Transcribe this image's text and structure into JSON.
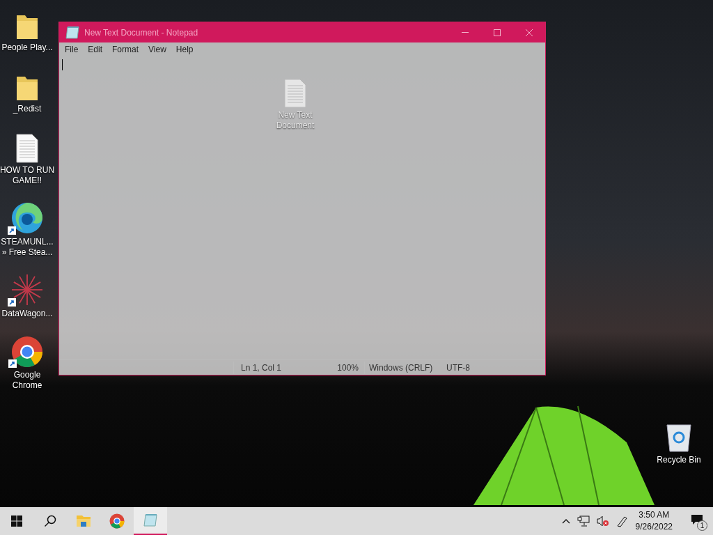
{
  "desktop_icons": [
    {
      "kind": "folder",
      "shortcut": false,
      "lines": [
        "People Play..."
      ]
    },
    {
      "kind": "folder",
      "shortcut": false,
      "lines": [
        "_Redist"
      ]
    },
    {
      "kind": "document",
      "shortcut": false,
      "lines": [
        "HOW TO RUN",
        "GAME!!"
      ]
    },
    {
      "kind": "browser-edge",
      "shortcut": true,
      "lines": [
        "STEAMUNL...",
        "» Free Stea..."
      ]
    },
    {
      "kind": "starburst",
      "shortcut": true,
      "lines": [
        "DataWagon..."
      ]
    },
    {
      "kind": "browser-chrome",
      "shortcut": true,
      "lines": [
        "Google",
        "Chrome"
      ]
    }
  ],
  "inner_icon": {
    "kind": "document",
    "shortcut": false,
    "lines": [
      "New Text",
      "Document"
    ]
  },
  "recycle_bin": {
    "kind": "bin",
    "shortcut": false,
    "lines": [
      "Recycle Bin"
    ]
  },
  "notepad": {
    "title": "New Text Document - Notepad",
    "menu": [
      "File",
      "Edit",
      "Format",
      "View",
      "Help"
    ],
    "status_bar": [
      "Ln 1, Col 1",
      "100%",
      "Windows (CRLF)",
      "UTF-8"
    ]
  },
  "taskbar": {
    "items": [
      {
        "kind": "start",
        "selected": false
      },
      {
        "kind": "search",
        "selected": false
      },
      {
        "kind": "explorer",
        "selected": false
      },
      {
        "kind": "chrome",
        "selected": false
      },
      {
        "kind": "notepad",
        "selected": true
      }
    ],
    "clock": {
      "time": "3:50 AM",
      "date": "9/26/2022"
    },
    "notifications": "1"
  }
}
